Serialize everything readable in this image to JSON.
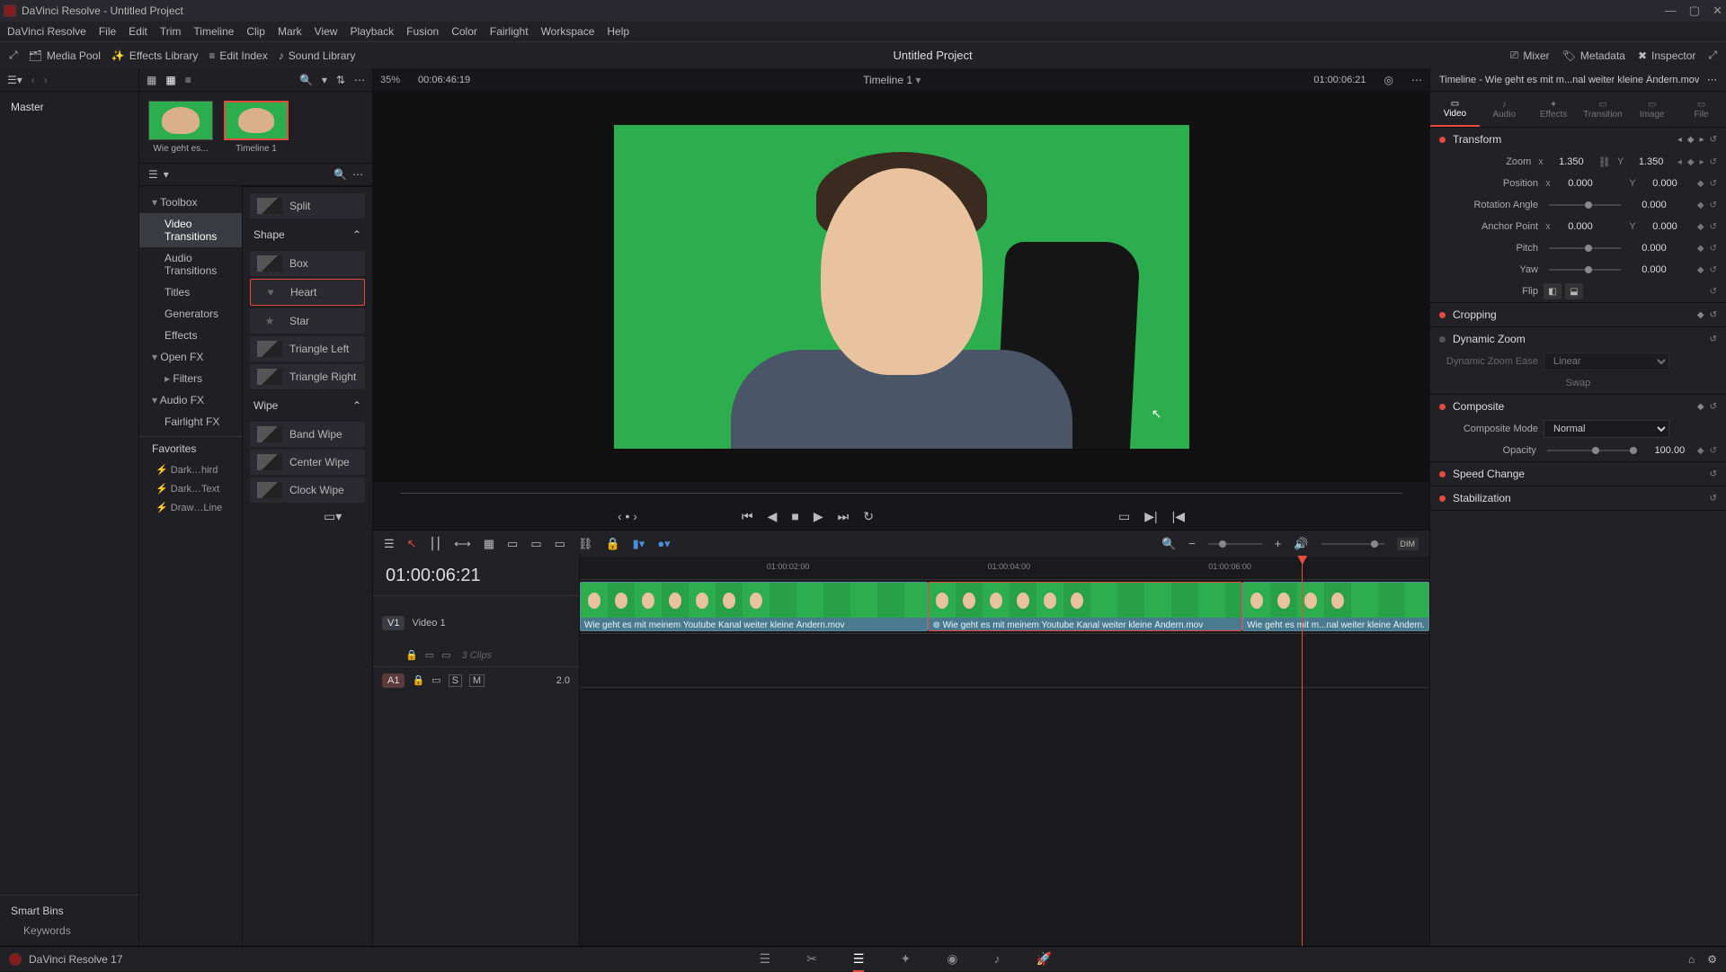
{
  "window": {
    "title": "DaVinci Resolve - Untitled Project"
  },
  "menu": [
    "DaVinci Resolve",
    "File",
    "Edit",
    "Trim",
    "Timeline",
    "Clip",
    "Mark",
    "View",
    "Playback",
    "Fusion",
    "Color",
    "Fairlight",
    "Workspace",
    "Help"
  ],
  "toolbar": {
    "media_pool": "Media Pool",
    "effects_library": "Effects Library",
    "edit_index": "Edit Index",
    "sound_library": "Sound Library",
    "project": "Untitled Project",
    "mixer": "Mixer",
    "metadata": "Metadata",
    "inspector": "Inspector"
  },
  "subheader": {
    "zoom": "35%",
    "tc_in": "00:06:46:19",
    "timeline_name": "Timeline 1",
    "tc_out": "01:00:06:21",
    "insp_title": "Timeline - Wie geht es mit m...nal weiter kleine Ändern.mov"
  },
  "master": {
    "label": "Master",
    "smartbins": "Smart Bins",
    "keywords": "Keywords"
  },
  "clips": [
    {
      "name": "Wie geht es..."
    },
    {
      "name": "Timeline 1"
    }
  ],
  "fx_tree": {
    "toolbox": "Toolbox",
    "video_transitions": "Video Transitions",
    "audio_transitions": "Audio Transitions",
    "titles": "Titles",
    "generators": "Generators",
    "effects": "Effects",
    "open_fx": "Open FX",
    "filters": "Filters",
    "audio_fx": "Audio FX",
    "fairlight_fx": "Fairlight FX",
    "favorites": "Favorites",
    "fav_items": [
      "Dark…hird",
      "Dark…Text",
      "Draw…Line"
    ]
  },
  "transitions": {
    "split": "Split",
    "shape": "Shape",
    "shape_items": [
      "Box",
      "Heart",
      "Star",
      "Triangle Left",
      "Triangle Right"
    ],
    "wipe": "Wipe",
    "wipe_items": [
      "Band Wipe",
      "Center Wipe",
      "Clock Wipe"
    ]
  },
  "transport": {
    "tc": "01:00:06:21"
  },
  "timeline": {
    "v1_label": "V1",
    "v1_name": "Video 1",
    "clip_count": "3 Clips",
    "a1_label": "A1",
    "a1_gain": "2.0",
    "clip_name": "Wie geht es mit meinem Youtube Kanal weiter kleine Ändern.mov",
    "clip_name2": "Wie geht es mit meinem Youtube Kanal weiter kleine Ändern.mov",
    "clip_name3": "Wie geht es mit m...nal weiter kleine Ändern.mov",
    "ruler": [
      "01:00:02:00",
      "01:00:04:00",
      "01:00:06:00"
    ]
  },
  "inspector": {
    "tabs": [
      "Video",
      "Audio",
      "Effects",
      "Transition",
      "Image",
      "File"
    ],
    "transform": "Transform",
    "zoom_label": "Zoom",
    "zoom_x": "1.350",
    "zoom_y": "1.350",
    "position_label": "Position",
    "pos_x": "0.000",
    "pos_y": "0.000",
    "rotation_label": "Rotation Angle",
    "rotation": "0.000",
    "anchor_label": "Anchor Point",
    "anc_x": "0.000",
    "anc_y": "0.000",
    "pitch_label": "Pitch",
    "pitch": "0.000",
    "yaw_label": "Yaw",
    "yaw": "0.000",
    "flip_label": "Flip",
    "cropping": "Cropping",
    "dynamic_zoom": "Dynamic Zoom",
    "dz_ease_label": "Dynamic Zoom Ease",
    "dz_ease": "Linear",
    "swap": "Swap",
    "composite": "Composite",
    "comp_mode_label": "Composite Mode",
    "comp_mode": "Normal",
    "opacity_label": "Opacity",
    "opacity": "100.00",
    "speed": "Speed Change",
    "stabilization": "Stabilization"
  },
  "footer": {
    "version": "DaVinci Resolve 17"
  }
}
